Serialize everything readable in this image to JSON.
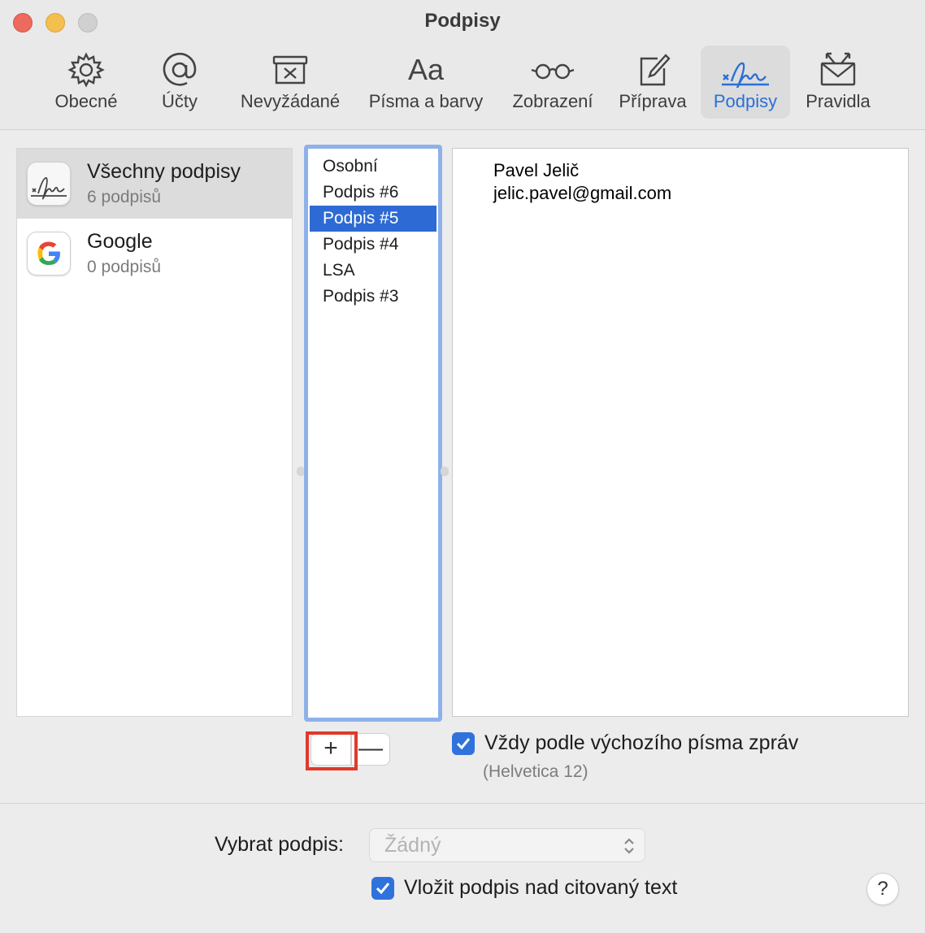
{
  "window": {
    "title": "Podpisy"
  },
  "toolbar": {
    "tabs": [
      {
        "label": "Obecné",
        "icon": "gear-icon"
      },
      {
        "label": "Účty",
        "icon": "at-icon"
      },
      {
        "label": "Nevyžádané",
        "icon": "junk-tray-icon"
      },
      {
        "label": "Písma a barvy",
        "icon": "fonts-icon"
      },
      {
        "label": "Zobrazení",
        "icon": "glasses-icon"
      },
      {
        "label": "Příprava",
        "icon": "compose-icon"
      },
      {
        "label": "Podpisy",
        "icon": "signature-icon"
      },
      {
        "label": "Pravidla",
        "icon": "rules-envelope-icon"
      }
    ],
    "active_tab": "Podpisy"
  },
  "accounts": [
    {
      "name": "Všechny podpisy",
      "count": "6 podpisů",
      "icon": "signature-icon",
      "selected": true
    },
    {
      "name": "Google",
      "count": "0 podpisů",
      "icon": "google-logo-icon",
      "selected": false
    }
  ],
  "signatures": [
    {
      "label": "Osobní",
      "selected": false
    },
    {
      "label": "Podpis #6",
      "selected": false
    },
    {
      "label": "Podpis #5",
      "selected": true
    },
    {
      "label": "Podpis #4",
      "selected": false
    },
    {
      "label": "LSA",
      "selected": false
    },
    {
      "label": "Podpis #3",
      "selected": false
    }
  ],
  "preview": {
    "lines": [
      "Pavel Jelič",
      "jelic.pavel@gmail.com"
    ]
  },
  "buttons": {
    "add": "+",
    "remove": "—",
    "help": "?"
  },
  "options": {
    "default_font_label": "Vždy podle výchozího písma zpráv",
    "default_font_checked": true,
    "font_info": "(Helvetica 12)",
    "select_label": "Vybrat podpis:",
    "select_value": "Žádný",
    "place_above_label": "Vložit podpis nad citovaný text",
    "place_above_checked": true
  },
  "colors": {
    "accent": "#2d6ad3",
    "highlight_box": "#e0392b"
  }
}
